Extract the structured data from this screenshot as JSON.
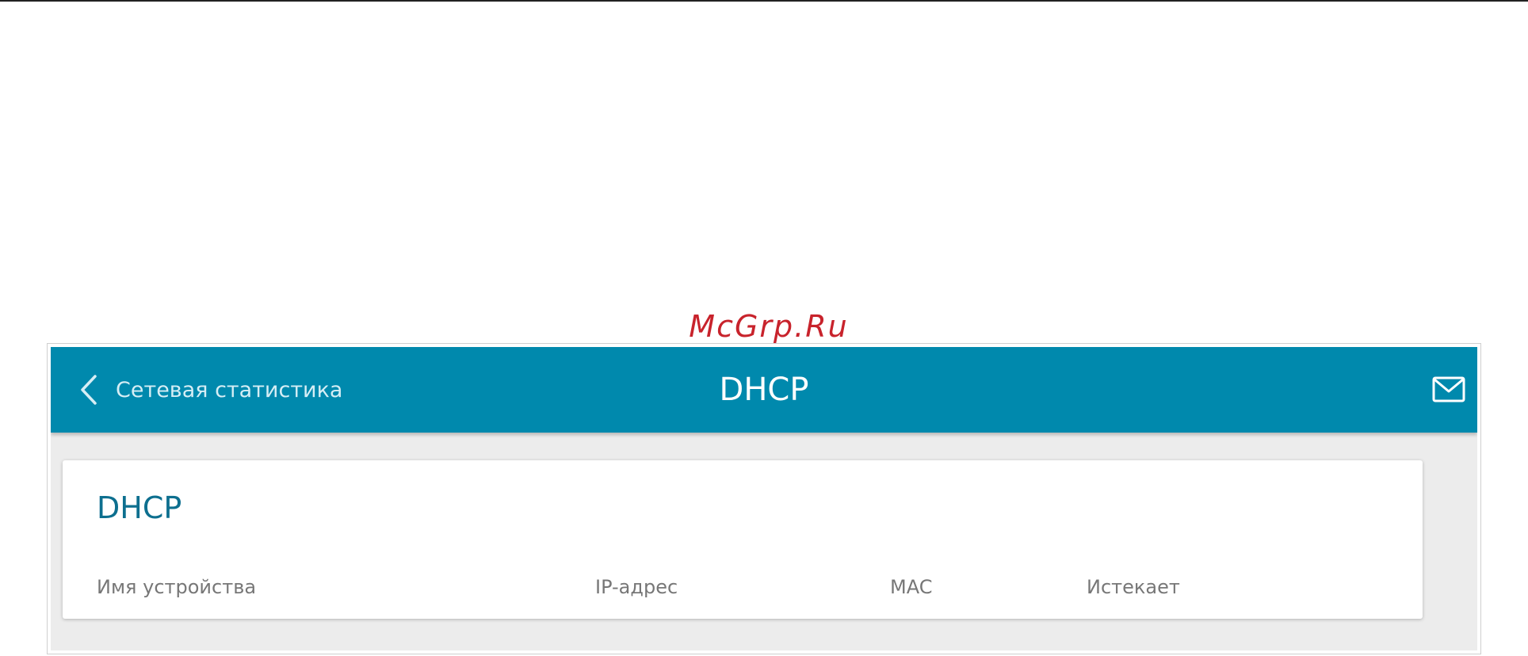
{
  "watermark": "McGrp.Ru",
  "header": {
    "back_label": "Сетевая статистика",
    "title": "DHCP",
    "icons": {
      "back": "chevron-left-icon",
      "mail": "mail-icon"
    }
  },
  "card": {
    "title": "DHCP",
    "columns": [
      "Имя устройства",
      "IP-адрес",
      "MAC",
      "Истекает"
    ]
  },
  "colors": {
    "header_bg": "#0089ad",
    "card_title": "#0d6f8f",
    "watermark": "#c8232c",
    "page_bg": "#ececec"
  }
}
